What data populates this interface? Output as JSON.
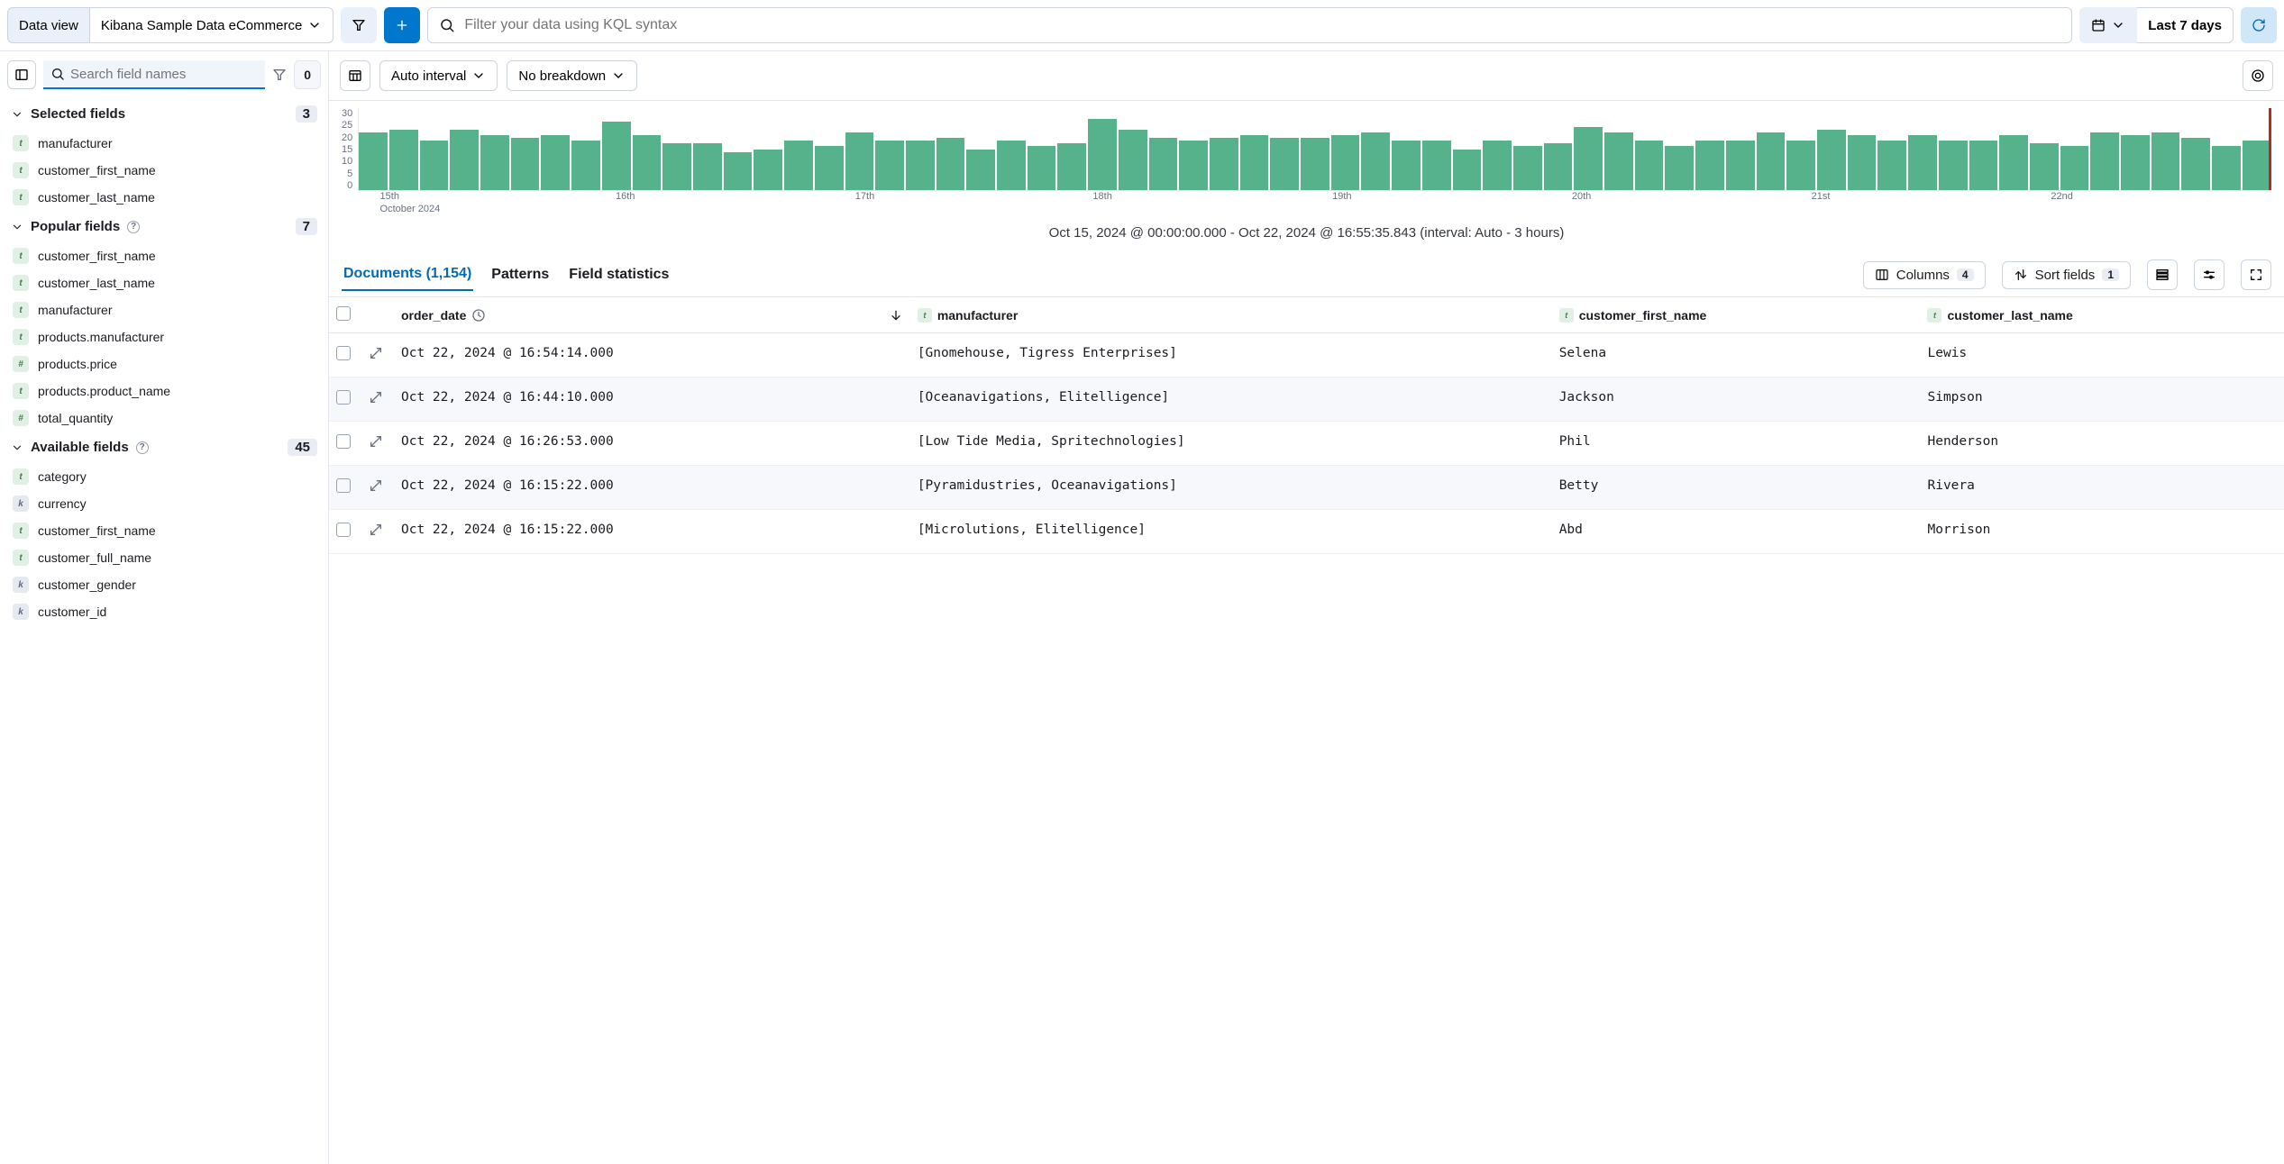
{
  "topbar": {
    "data_view_label": "Data view",
    "data_view_name": "Kibana Sample Data eCommerce",
    "search_placeholder": "Filter your data using KQL syntax",
    "date_range": "Last 7 days"
  },
  "sidebar": {
    "search_placeholder": "Search field names",
    "filter_count": "0",
    "selected": {
      "label": "Selected fields",
      "count": "3",
      "items": [
        {
          "type": "t",
          "name": "manufacturer"
        },
        {
          "type": "t",
          "name": "customer_first_name"
        },
        {
          "type": "t",
          "name": "customer_last_name"
        }
      ]
    },
    "popular": {
      "label": "Popular fields",
      "count": "7",
      "items": [
        {
          "type": "t",
          "name": "customer_first_name"
        },
        {
          "type": "t",
          "name": "customer_last_name"
        },
        {
          "type": "t",
          "name": "manufacturer"
        },
        {
          "type": "t",
          "name": "products.manufacturer"
        },
        {
          "type": "n",
          "name": "products.price"
        },
        {
          "type": "t",
          "name": "products.product_name"
        },
        {
          "type": "n",
          "name": "total_quantity"
        }
      ]
    },
    "available": {
      "label": "Available fields",
      "count": "45",
      "items": [
        {
          "type": "t",
          "name": "category"
        },
        {
          "type": "k",
          "name": "currency"
        },
        {
          "type": "t",
          "name": "customer_first_name"
        },
        {
          "type": "t",
          "name": "customer_full_name"
        },
        {
          "type": "k",
          "name": "customer_gender"
        },
        {
          "type": "k",
          "name": "customer_id"
        }
      ]
    }
  },
  "toolbar": {
    "interval_label": "Auto interval",
    "breakdown_label": "No breakdown"
  },
  "chart_data": {
    "type": "bar",
    "ylim": [
      0,
      30
    ],
    "yticks": [
      "30",
      "25",
      "20",
      "15",
      "10",
      "5",
      "0"
    ],
    "xticks": [
      {
        "pos": 0.5,
        "label": "15th"
      },
      {
        "pos": 12.9,
        "label": "16th"
      },
      {
        "pos": 25.5,
        "label": "17th"
      },
      {
        "pos": 38.0,
        "label": "18th"
      },
      {
        "pos": 50.6,
        "label": "19th"
      },
      {
        "pos": 63.2,
        "label": "20th"
      },
      {
        "pos": 75.8,
        "label": "21st"
      },
      {
        "pos": 88.4,
        "label": "22nd"
      }
    ],
    "xmonth": "October 2024",
    "values": [
      21,
      22,
      18,
      22,
      20,
      19,
      20,
      18,
      25,
      20,
      17,
      17,
      14,
      15,
      18,
      16,
      21,
      18,
      18,
      19,
      15,
      18,
      16,
      17,
      26,
      22,
      19,
      18,
      19,
      20,
      19,
      19,
      20,
      21,
      18,
      18,
      15,
      18,
      16,
      17,
      23,
      21,
      18,
      16,
      18,
      18,
      21,
      18,
      22,
      20,
      18,
      20,
      18,
      18,
      20,
      17,
      16,
      21,
      20,
      21,
      19,
      16,
      18
    ],
    "caption": "Oct 15, 2024 @ 00:00:00.000 - Oct 22, 2024 @ 16:55:35.843 (interval: Auto - 3 hours)"
  },
  "tabs": {
    "documents": "Documents (1,154)",
    "patterns": "Patterns",
    "field_stats": "Field statistics",
    "columns_label": "Columns",
    "columns_count": "4",
    "sort_label": "Sort fields",
    "sort_count": "1"
  },
  "table": {
    "columns": [
      "order_date",
      "manufacturer",
      "customer_first_name",
      "customer_last_name"
    ],
    "rows": [
      {
        "date": "Oct 22, 2024 @ 16:54:14.000",
        "manufacturer": "[Gnomehouse, Tigress Enterprises]",
        "first": "Selena",
        "last": "Lewis"
      },
      {
        "date": "Oct 22, 2024 @ 16:44:10.000",
        "manufacturer": "[Oceanavigations, Elitelligence]",
        "first": "Jackson",
        "last": "Simpson"
      },
      {
        "date": "Oct 22, 2024 @ 16:26:53.000",
        "manufacturer": "[Low Tide Media, Spritechnologies]",
        "first": "Phil",
        "last": "Henderson"
      },
      {
        "date": "Oct 22, 2024 @ 16:15:22.000",
        "manufacturer": "[Pyramidustries, Oceanavigations]",
        "first": "Betty",
        "last": "Rivera"
      },
      {
        "date": "Oct 22, 2024 @ 16:15:22.000",
        "manufacturer": "[Microlutions, Elitelligence]",
        "first": "Abd",
        "last": "Morrison"
      }
    ]
  }
}
